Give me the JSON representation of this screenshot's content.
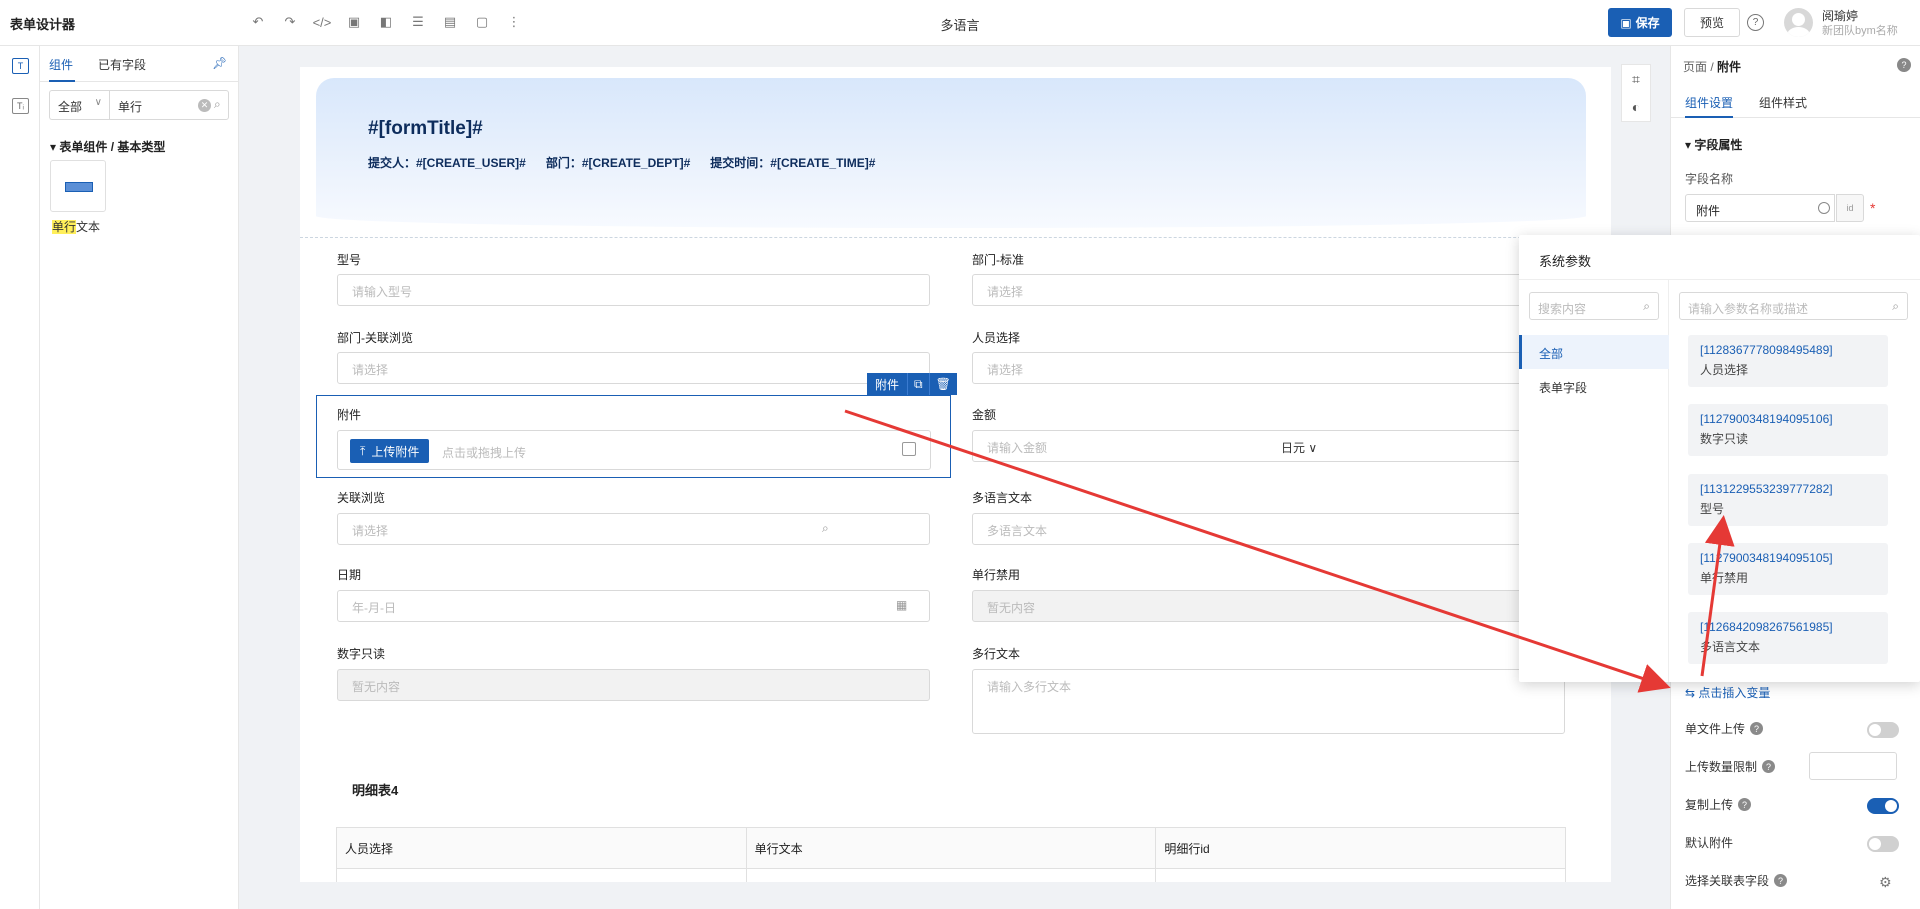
{
  "app_title": "表单设计器",
  "page_title": "多语言",
  "toolbar": {
    "save": "保存",
    "preview": "预览"
  },
  "user": {
    "name": "阅瑜婷",
    "org": "新团队bym名称"
  },
  "left_panel": {
    "tabs": [
      "组件",
      "已有字段"
    ],
    "filter_select": "全部",
    "filter_value": "单行",
    "group_title": "表单组件 / 基本类型",
    "component_highlight": "单行",
    "component_rest": "文本"
  },
  "form": {
    "title": "#[formTitle]#",
    "meta": [
      "提交人：#[CREATE_USER]#",
      "部门：#[CREATE_DEPT]#",
      "提交时间：#[CREATE_TIME]#"
    ],
    "fields": {
      "model": {
        "label": "型号",
        "placeholder": "请输入型号"
      },
      "dept_std": {
        "label": "部门-标准",
        "placeholder": "请选择"
      },
      "dept_browse": {
        "label": "部门-关联浏览",
        "placeholder": "请选择"
      },
      "person": {
        "label": "人员选择",
        "placeholder": "请选择"
      },
      "attachment": {
        "label": "附件",
        "upload": "上传附件",
        "hint": "点击或拖拽上传"
      },
      "amount": {
        "label": "金额",
        "placeholder": "请输入金额",
        "unit": "日元"
      },
      "link_browse": {
        "label": "关联浏览",
        "placeholder": "请选择"
      },
      "ml_text": {
        "label": "多语言文本",
        "placeholder": "多语言文本"
      },
      "date": {
        "label": "日期",
        "placeholder": "年-月-日"
      },
      "single_disabled": {
        "label": "单行禁用",
        "placeholder": "暂无内容"
      },
      "number_ro": {
        "label": "数字只读",
        "placeholder": "暂无内容"
      },
      "multi_text": {
        "label": "多行文本",
        "placeholder": "请输入多行文本"
      }
    },
    "selected_tag": "附件",
    "detail_title": "明细表4",
    "detail_columns": [
      "人员选择",
      "单行文本",
      "明细行id"
    ]
  },
  "right_panel": {
    "breadcrumb_parent": "页面",
    "breadcrumb_current": "附件",
    "tabs": [
      "组件设置",
      "组件样式"
    ],
    "section": "字段属性",
    "field_name_label": "字段名称",
    "field_name_value": "附件",
    "insert_var": "点击插入变量",
    "single_upload": "单文件上传",
    "upload_limit": "上传数量限制",
    "copy_upload": "复制上传",
    "default_attach": "默认附件",
    "link_field": "选择关联表字段",
    "toggles": {
      "single_upload": false,
      "copy_upload": true,
      "default_attach": false
    }
  },
  "popup": {
    "title": "系统参数",
    "search_placeholder": "搜索内容",
    "param_search_placeholder": "请输入参数名称或描述",
    "categories": [
      "全部",
      "表单字段"
    ],
    "params": [
      {
        "id": "[1128367778098495489]",
        "name": "人员选择"
      },
      {
        "id": "[1127900348194095106]",
        "name": "数字只读"
      },
      {
        "id": "[1131229553239777282]",
        "name": "型号"
      },
      {
        "id": "[1127900348194095105]",
        "name": "单行禁用"
      },
      {
        "id": "[1126842098267561985]",
        "name": "多语言文本"
      }
    ]
  },
  "colors": {
    "primary": "#1a5fb4",
    "annotation_arrow": "#e53935"
  }
}
